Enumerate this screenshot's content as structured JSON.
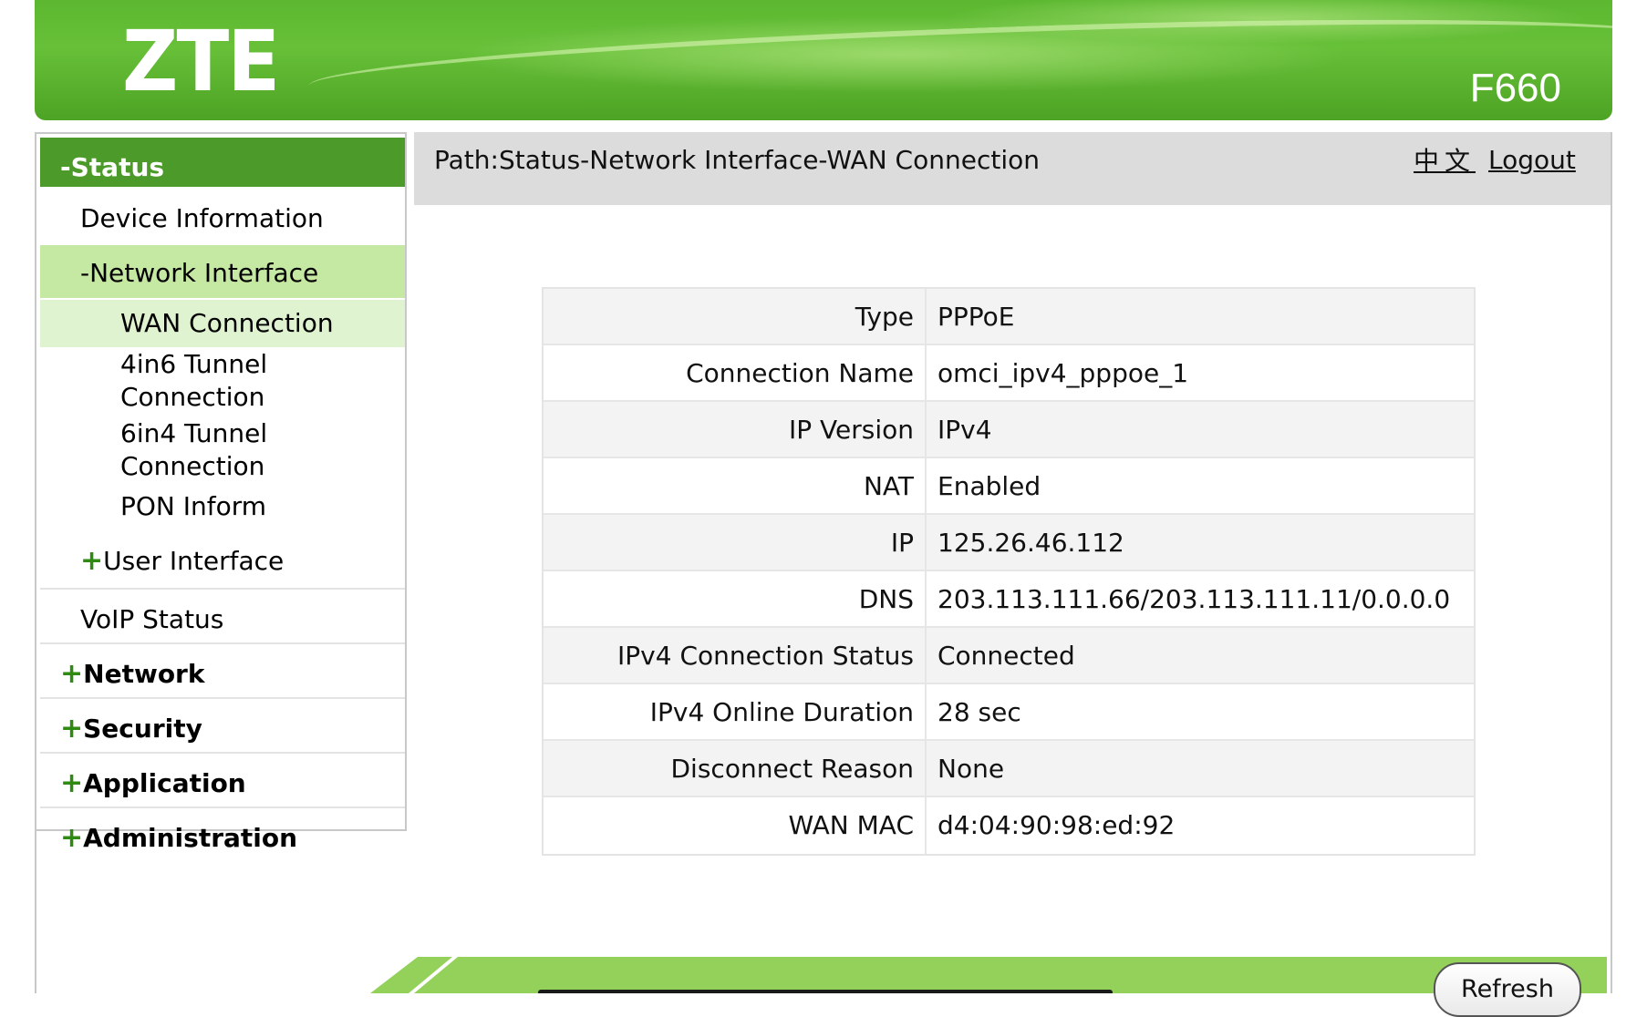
{
  "header": {
    "logo": "ZTE",
    "model": "F660"
  },
  "sidebar": {
    "status": "-Status",
    "device_information": "Device Information",
    "network_interface": "-Network Interface",
    "wan_connection": "WAN Connection",
    "tunnel_4in6_line1": "4in6 Tunnel",
    "tunnel_4in6_line2": "Connection",
    "tunnel_6in4_line1": "6in4 Tunnel",
    "tunnel_6in4_line2": "Connection",
    "pon_inform": "PON Inform",
    "user_interface": "User Interface",
    "voip_status": "VoIP Status",
    "network": "Network",
    "security": "Security",
    "application": "Application",
    "administration": "Administration",
    "plus": "+"
  },
  "pathbar": {
    "path": "Path:Status-Network Interface-WAN Connection",
    "language": "中文",
    "logout": "Logout"
  },
  "info": {
    "rows": [
      {
        "label": "Type",
        "value": "PPPoE"
      },
      {
        "label": "Connection Name",
        "value": "omci_ipv4_pppoe_1"
      },
      {
        "label": "IP Version",
        "value": "IPv4"
      },
      {
        "label": "NAT",
        "value": "Enabled"
      },
      {
        "label": "IP",
        "value": "125.26.46.112"
      },
      {
        "label": "DNS",
        "value": "203.113.111.66/203.113.111.11/0.0.0.0"
      },
      {
        "label": "IPv4 Connection Status",
        "value": "Connected"
      },
      {
        "label": "IPv4 Online Duration",
        "value": "28 sec"
      },
      {
        "label": "Disconnect Reason",
        "value": "None"
      },
      {
        "label": "WAN MAC",
        "value": "d4:04:90:98:ed:92"
      }
    ]
  },
  "footer": {
    "refresh": "Refresh"
  },
  "colors": {
    "header_green": "#5cb830",
    "status_green": "#4c9a2a",
    "selected_light_green": "#c5e8a2",
    "footer_green": "#93d15a"
  }
}
